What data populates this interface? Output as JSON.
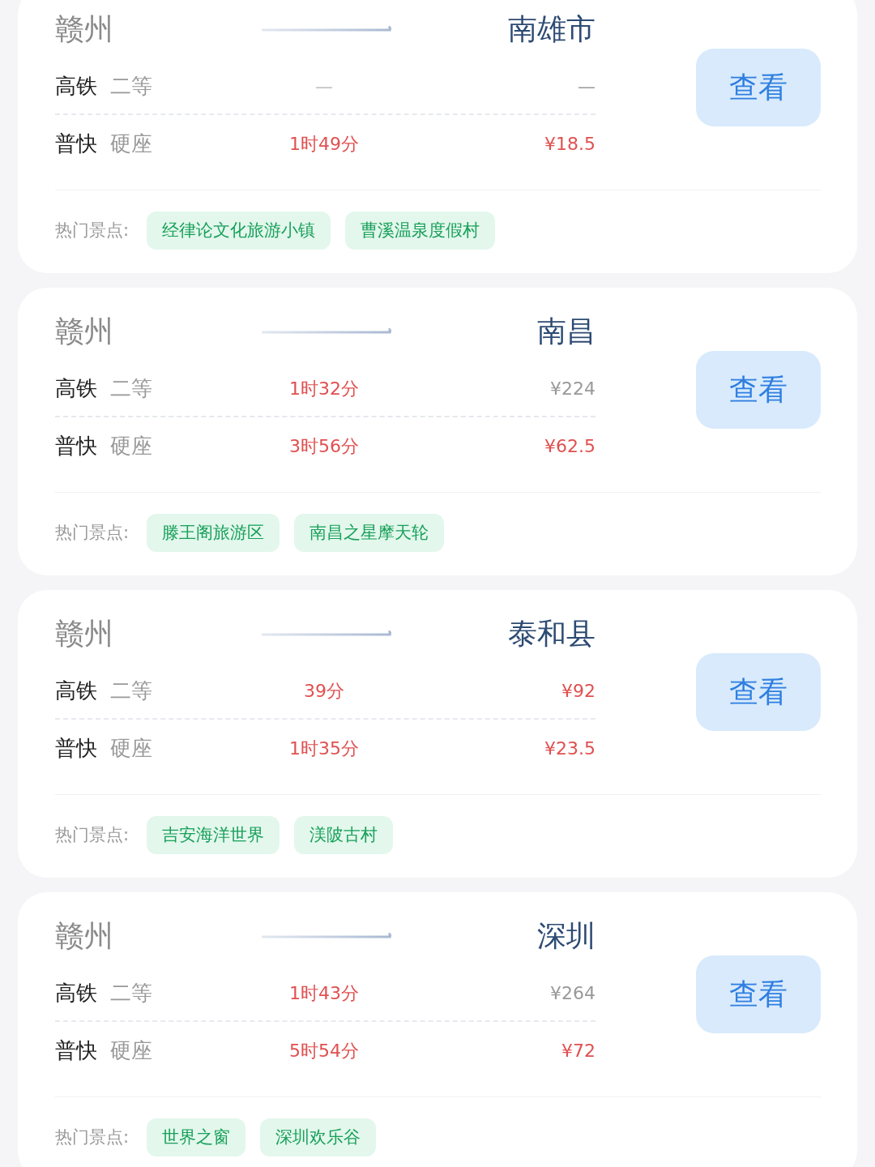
{
  "routes": [
    {
      "origin": "赣州",
      "destination": "南雄市",
      "button": "查看",
      "trains": [
        {
          "type": "高铁",
          "seat": "二等",
          "duration": {
            "text": "—",
            "highlighted": false
          },
          "price": {
            "text": "—",
            "highlighted": false
          }
        },
        {
          "type": "普快",
          "seat": "硬座",
          "duration": {
            "text": "1时49分",
            "highlighted": true
          },
          "price": {
            "text": "¥18.5",
            "highlighted": true
          }
        }
      ],
      "spots_label": "热门景点:",
      "spots": [
        "经律论文化旅游小镇",
        "曹溪温泉度假村"
      ]
    },
    {
      "origin": "赣州",
      "destination": "南昌",
      "button": "查看",
      "trains": [
        {
          "type": "高铁",
          "seat": "二等",
          "duration": {
            "text": "1时32分",
            "highlighted": true
          },
          "price": {
            "text": "¥224",
            "highlighted": false
          }
        },
        {
          "type": "普快",
          "seat": "硬座",
          "duration": {
            "text": "3时56分",
            "highlighted": true
          },
          "price": {
            "text": "¥62.5",
            "highlighted": true
          }
        }
      ],
      "spots_label": "热门景点:",
      "spots": [
        "滕王阁旅游区",
        "南昌之星摩天轮"
      ]
    },
    {
      "origin": "赣州",
      "destination": "泰和县",
      "button": "查看",
      "trains": [
        {
          "type": "高铁",
          "seat": "二等",
          "duration": {
            "text": "39分",
            "highlighted": true
          },
          "price": {
            "text": "¥92",
            "highlighted": true
          }
        },
        {
          "type": "普快",
          "seat": "硬座",
          "duration": {
            "text": "1时35分",
            "highlighted": true
          },
          "price": {
            "text": "¥23.5",
            "highlighted": true
          }
        }
      ],
      "spots_label": "热门景点:",
      "spots": [
        "吉安海洋世界",
        "渼陂古村"
      ]
    },
    {
      "origin": "赣州",
      "destination": "深圳",
      "button": "查看",
      "trains": [
        {
          "type": "高铁",
          "seat": "二等",
          "duration": {
            "text": "1时43分",
            "highlighted": true
          },
          "price": {
            "text": "¥264",
            "highlighted": false
          }
        },
        {
          "type": "普快",
          "seat": "硬座",
          "duration": {
            "text": "5时54分",
            "highlighted": true
          },
          "price": {
            "text": "¥72",
            "highlighted": true
          }
        }
      ],
      "spots_label": "热门景点:",
      "spots": [
        "世界之窗",
        "深圳欢乐谷"
      ]
    }
  ]
}
